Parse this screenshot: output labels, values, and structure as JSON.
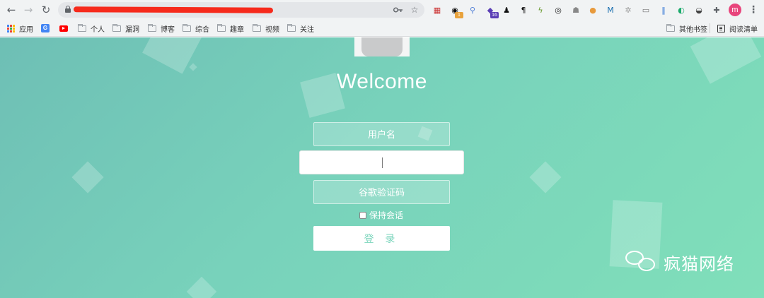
{
  "browser": {
    "nav": {
      "back": "←",
      "forward": "→",
      "reload": "↻"
    },
    "url": "",
    "omnibox_icons": {
      "key": "key-icon",
      "star": "star-icon"
    },
    "extensions": [
      {
        "name": "flag-extension-icon",
        "glyph": "▦",
        "color": "#c33"
      },
      {
        "name": "circle-extension-icon",
        "glyph": "◉",
        "color": "#111",
        "badge": "1",
        "badge_color": "#e8a23c"
      },
      {
        "name": "pin-extension-icon",
        "glyph": "⚲",
        "color": "#4a7bd6"
      },
      {
        "name": "cube-extension-icon",
        "glyph": "◆",
        "color": "#5b3fb5",
        "badge": "16",
        "badge_color": "#5b3fb5"
      },
      {
        "name": "user-extension-icon",
        "glyph": "♟",
        "color": "#111"
      },
      {
        "name": "paragraph-extension-icon",
        "glyph": "¶",
        "color": "#111"
      },
      {
        "name": "bolt-extension-icon",
        "glyph": "ϟ",
        "color": "#6a9a2f"
      },
      {
        "name": "ring-extension-icon",
        "glyph": "◎",
        "color": "#222"
      },
      {
        "name": "robot-extension-icon",
        "glyph": "☗",
        "color": "#888"
      },
      {
        "name": "cookie-extension-icon",
        "glyph": "●",
        "color": "#e89a3c"
      },
      {
        "name": "m-extension-icon",
        "glyph": "M",
        "color": "#1a6fb0"
      },
      {
        "name": "gear-extension-icon",
        "glyph": "✲",
        "color": "#999"
      },
      {
        "name": "screen-extension-icon",
        "glyph": "▭",
        "color": "#777"
      },
      {
        "name": "bars-extension-icon",
        "glyph": "‖",
        "color": "#3b7bd6"
      },
      {
        "name": "vue-extension-icon",
        "glyph": "◐",
        "color": "#1aaa6b"
      },
      {
        "name": "hat-extension-icon",
        "glyph": "◒",
        "color": "#444"
      },
      {
        "name": "puzzle-extension-icon",
        "glyph": "✚",
        "color": "#5f6368"
      }
    ],
    "profile_initial": "m"
  },
  "bookmarks": {
    "apps_label": "应用",
    "items": [
      "个人",
      "漏洞",
      "博客",
      "综合",
      "趣章",
      "视频",
      "关注"
    ],
    "other_label": "其他书签",
    "reading_list_label": "阅读清单"
  },
  "login": {
    "welcome": "Welcome",
    "username_placeholder": "用户名",
    "captcha_placeholder": "谷歌验证码",
    "remember_label": "保持会话",
    "login_button": "登 录"
  },
  "watermark": {
    "text": "疯猫网络"
  }
}
